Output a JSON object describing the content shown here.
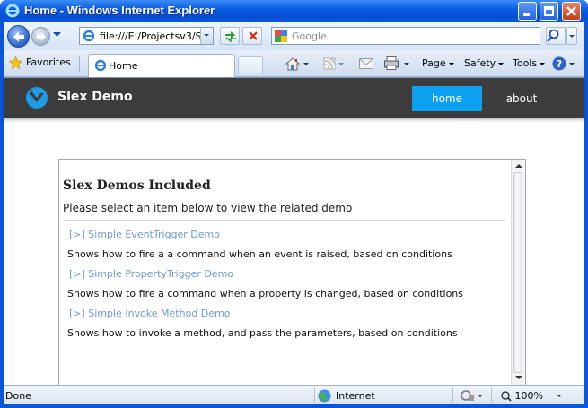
{
  "window": {
    "title": "Home - Windows Internet Explorer"
  },
  "navbar": {
    "address": "file:///E:/Projectsv3/Sl",
    "search_placeholder": "Google"
  },
  "favbar": {
    "favorites_label": "Favorites",
    "tab_label": "Home",
    "commands": {
      "page": "Page",
      "safety": "Safety",
      "tools": "Tools"
    }
  },
  "site": {
    "brand": "Slex Demo",
    "nav": {
      "home": "home",
      "about": "about"
    }
  },
  "panel": {
    "title": "Slex Demos Included",
    "subtitle": "Please select an item below to view the related demo",
    "demos": [
      {
        "link": "[>] Simple EventTrigger Demo",
        "description": "Shows how to fire a a command when an event is raised, based on conditions"
      },
      {
        "link": "[>] Simple PropertyTrigger Demo",
        "description": "Shows how to fire a command when a property is changed, based on conditions"
      },
      {
        "link": "[>] Simple Invoke Method Demo",
        "description": "Shows how to invoke a method, and pass the parameters, based on conditions"
      }
    ]
  },
  "status": {
    "text": "Done",
    "zone": "Internet",
    "zoom": "100%"
  },
  "colors": {
    "header_bg": "#3c3c3c",
    "nav_active": "#0da0f0",
    "link": "#6e9ccf"
  }
}
